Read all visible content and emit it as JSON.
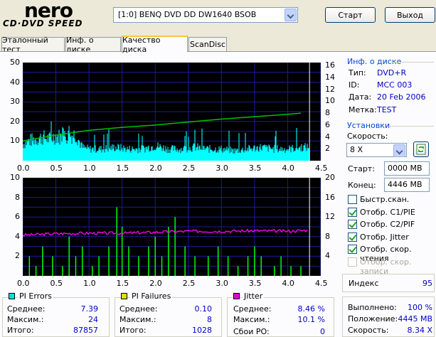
{
  "header": {
    "logo_main": "nero",
    "logo_sub": "CD·DVD SPEED",
    "drive": "[1:0]  BENQ DVD DD DW1640 BSOB",
    "start_label": "Старт",
    "exit_label": "Выход"
  },
  "tabs": [
    "Эталонный тест",
    "Инф. о диске",
    "Качество диска",
    "ScanDisc"
  ],
  "disc_info": {
    "title": "Инф. о диске",
    "type_label": "Тип:",
    "type_value": "DVD+R",
    "id_label": "ID:",
    "id_value": "MCC 003",
    "date_label": "Дата:",
    "date_value": "20 Feb 2006",
    "mark_label": "Метка:",
    "mark_value": "TEST"
  },
  "settings": {
    "title": "Установки",
    "speed_label": "Скорость:",
    "speed_value": "8 X",
    "start_label": "Старт:",
    "start_value": "0000 MB",
    "end_label": "Конец:",
    "end_value": "4446 MB",
    "checkboxes": [
      {
        "label": "Быстр.скан.",
        "checked": false,
        "disabled": false
      },
      {
        "label": "Отобр. C1/PIE",
        "checked": true,
        "disabled": false
      },
      {
        "label": "Отобр. C2/PIF",
        "checked": true,
        "disabled": false
      },
      {
        "label": "Отобр. Jitter",
        "checked": true,
        "disabled": false
      },
      {
        "label": "Отобр. скор. чтения",
        "checked": true,
        "disabled": false
      },
      {
        "label": "Отобр. скор. записи",
        "checked": false,
        "disabled": true
      }
    ]
  },
  "index": {
    "label": "Индекс",
    "value": "95"
  },
  "progress": {
    "done_label": "Выполнено:",
    "done_value": "100 %",
    "pos_label": "Положение:",
    "pos_value": "4445 MB",
    "speed_label": "Скорость:",
    "speed_value": "8.34 X"
  },
  "stats": {
    "pie": {
      "title": "PI Errors",
      "color": "#00e0e0",
      "avg_label": "Среднее:",
      "avg": "7.39",
      "max_label": "Максим.:",
      "max": "24",
      "total_label": "Итого:",
      "total": "87857"
    },
    "pif": {
      "title": "PI Failures",
      "color": "#e0e000",
      "avg_label": "Среднее:",
      "avg": "0.10",
      "max_label": "Максим.:",
      "max": "8",
      "total_label": "Итого:",
      "total": "1028"
    },
    "jitter": {
      "title": "Jitter",
      "color": "#e000e0",
      "avg_label": "Среднее:",
      "avg": "8.46 %",
      "max_label": "Максим.:",
      "max": "10.1 %",
      "po_label": "Сбои PO:",
      "po": "0"
    }
  },
  "chart_data": [
    {
      "type": "area",
      "x_ticks": [
        "0.0",
        "0.5",
        "1.0",
        "1.5",
        "2.0",
        "2.5",
        "3.0",
        "3.5",
        "4.0",
        "4.5"
      ],
      "xlim": [
        0,
        4.5
      ],
      "y_left_ticks": [
        "10",
        "20",
        "30",
        "40",
        "50"
      ],
      "ylim_left": [
        0,
        50
      ],
      "y_right_ticks": [
        "2",
        "4",
        "6",
        "8",
        "10",
        "12",
        "14",
        "16"
      ],
      "ylim_right": [
        0,
        16.5
      ],
      "series": [
        {
          "values_desc": "PI errors",
          "color": "#00ffff",
          "x": [
            0.0,
            0.1,
            0.2,
            0.3,
            0.4,
            0.5,
            0.6,
            0.7,
            0.8,
            0.9,
            1.0,
            1.2,
            1.4,
            1.6,
            1.8,
            2.0,
            2.2,
            2.4,
            2.6,
            2.8,
            3.0,
            3.2,
            3.4,
            3.6,
            3.8,
            4.0,
            4.2,
            4.33
          ],
          "y": [
            10,
            12,
            13,
            14,
            13,
            15,
            14,
            15,
            16,
            8,
            7,
            7,
            8,
            7,
            7,
            9,
            7,
            7,
            8,
            7,
            7,
            6,
            7,
            8,
            7,
            7,
            8,
            8
          ]
        },
        {
          "values_desc": "read speed",
          "color": "#00c000",
          "x": [
            0.0,
            0.5,
            1.0,
            1.5,
            2.0,
            2.5,
            3.0,
            3.5,
            4.0,
            4.2
          ],
          "y": [
            3.3,
            4.3,
            5.1,
            5.6,
            6.0,
            6.5,
            7.0,
            7.4,
            7.8,
            8.0
          ]
        }
      ]
    },
    {
      "type": "bar",
      "x_ticks": [
        "0.0",
        "0.5",
        "1.0",
        "1.5",
        "2.0",
        "2.5",
        "3.0",
        "3.5",
        "4.0",
        "4.5"
      ],
      "xlim": [
        0,
        4.5
      ],
      "y_left_ticks": [
        "2",
        "4",
        "6",
        "8",
        "10"
      ],
      "ylim_left": [
        0,
        10
      ],
      "y_right_ticks": [
        "4",
        "8",
        "12",
        "16",
        "20"
      ],
      "ylim_right": [
        0,
        20
      ],
      "series": [
        {
          "values_desc": "PI failures",
          "color": "#00ff00",
          "x": [
            0.1,
            0.2,
            0.3,
            0.45,
            0.6,
            0.7,
            0.8,
            0.9,
            1.05,
            1.15,
            1.3,
            1.42,
            1.5,
            1.6,
            1.75,
            1.9,
            2.0,
            2.1,
            2.2,
            2.3,
            2.45,
            2.6,
            2.8,
            2.95,
            3.1,
            3.25,
            3.4,
            3.5,
            3.6,
            3.8,
            3.9,
            4.05,
            4.2
          ],
          "y": [
            2,
            1,
            3,
            2,
            1,
            4,
            2,
            3,
            1,
            2,
            3,
            7,
            5,
            3,
            2,
            3,
            4,
            2,
            5,
            6,
            3,
            2,
            2,
            3,
            2,
            1,
            2,
            3,
            2,
            1,
            2,
            1,
            1
          ]
        },
        {
          "values_desc": "jitter",
          "color": "#ff00ff",
          "x": [
            0.0,
            0.5,
            1.0,
            1.5,
            2.0,
            2.5,
            3.0,
            3.5,
            4.0,
            4.3
          ],
          "y": [
            8.3,
            8.6,
            8.7,
            8.7,
            8.9,
            9.1,
            9.1,
            9.2,
            9.1,
            9.3
          ]
        }
      ]
    }
  ]
}
